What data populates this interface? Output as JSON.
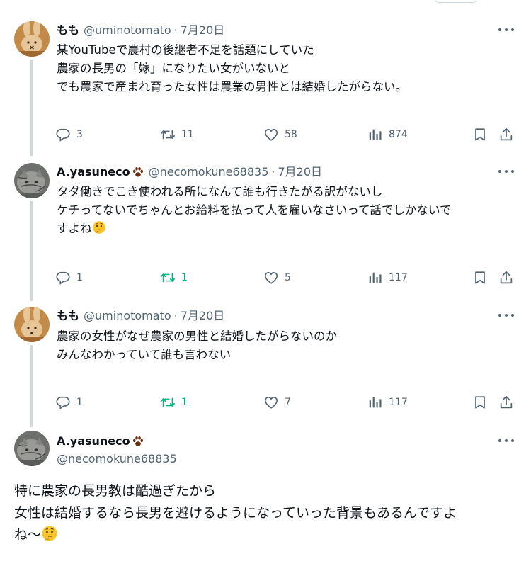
{
  "posts": [
    {
      "name": "もも",
      "handle": "@uminotomato",
      "date": "7月20日",
      "avatar": "miffy-avatar",
      "lines": [
        "某YouTubeで農村の後継者不足を話題にしていた",
        "農家の長男の「嫁」になりたい女がいないと",
        "",
        "でも農家で産まれ育った女性は農業の男性とは結婚したがらない。"
      ],
      "replies": "3",
      "reposts": "11",
      "likes": "58",
      "views": "874"
    },
    {
      "name": "A.yasuneco",
      "handle": "@necomokune68835",
      "date": "7月20日",
      "avatar": "cat-avatar",
      "lines": [
        "タダ働きでこき使われる所になんて誰も行きたがる訳がないし",
        "",
        "ケチってないでちゃんとお給料を払って人を雇いなさいって話でしかないで",
        "すよね"
      ],
      "replies": "1",
      "reposts": "1",
      "likes": "5",
      "views": "117"
    },
    {
      "name": "もも",
      "handle": "@uminotomato",
      "date": "7月20日",
      "avatar": "miffy-avatar",
      "lines": [
        "農家の女性がなぜ農家の男性と結婚したがらないのか",
        "",
        "みんなわかっていて誰も言わない"
      ],
      "replies": "1",
      "reposts": "1",
      "likes": "7",
      "views": "117"
    }
  ],
  "main_post": {
    "name": "A.yasuneco",
    "handle": "@necomokune68835",
    "avatar": "cat-avatar",
    "lines": [
      "特に農家の長男教は酷過ぎたから",
      "",
      "女性は結婚するなら長男を避けるようになっていった背景もあるんですよ",
      "ね〜"
    ]
  },
  "dot_sep": "·",
  "icons": [
    "reply-icon",
    "repost-icon",
    "like-icon",
    "views-icon",
    "bookmark-icon",
    "share-icon",
    "more-icon",
    "paw-icon",
    "thinking-emoji"
  ],
  "colors": {
    "text": "#0f1419",
    "secondary": "#536471",
    "repost_active": "#00ba7c",
    "thread_line": "#cfd9de"
  }
}
